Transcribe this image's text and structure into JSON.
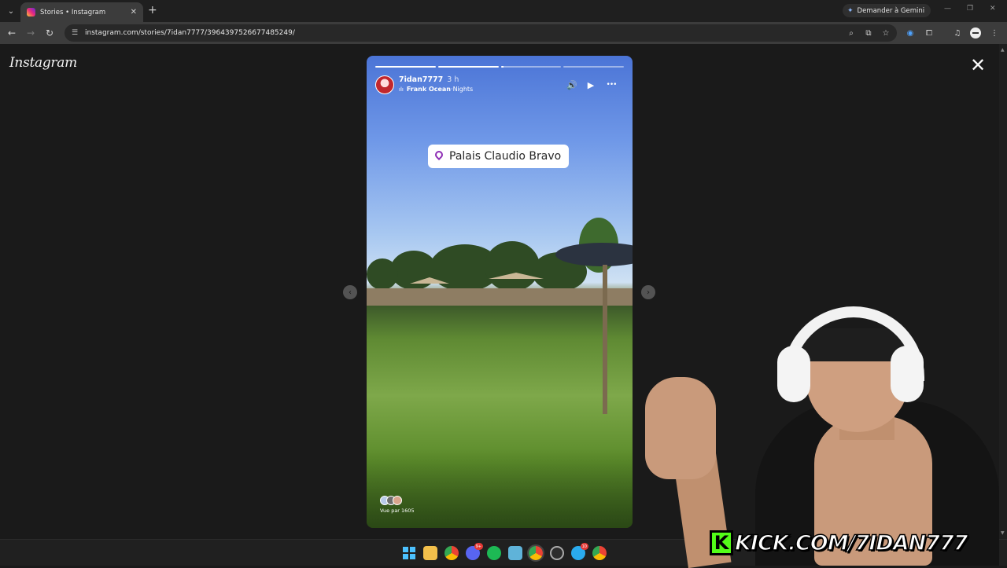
{
  "browser": {
    "tab_title": "Stories • Instagram",
    "url": "instagram.com/stories/7idan7777/3964397526677485249/",
    "gemini_label": "Demander à Gemini"
  },
  "page": {
    "logo": "Instagram",
    "close": "✕"
  },
  "story": {
    "progress": [
      1.0,
      1.0,
      0.05,
      0.0
    ],
    "username": "7idan7777",
    "time": "3 h",
    "music_artist": "Frank Ocean",
    "music_separator": " · ",
    "music_song": "Nights",
    "location": "Palais Claudio Bravo",
    "viewers_label": "Vue par 1605",
    "prev_glyph": "‹",
    "next_glyph": "›"
  },
  "controls": {
    "volume_icon": "🔊",
    "play_icon": "▶",
    "more_icon": "•••"
  },
  "taskbar": {
    "discord_badge": "9+",
    "telegram_badge": "10"
  },
  "overlay": {
    "kick_text": "KICK.COM/7IDAN777"
  },
  "colors": {
    "accent_pin": "#8e2db5",
    "kick_green": "#53fc18"
  }
}
